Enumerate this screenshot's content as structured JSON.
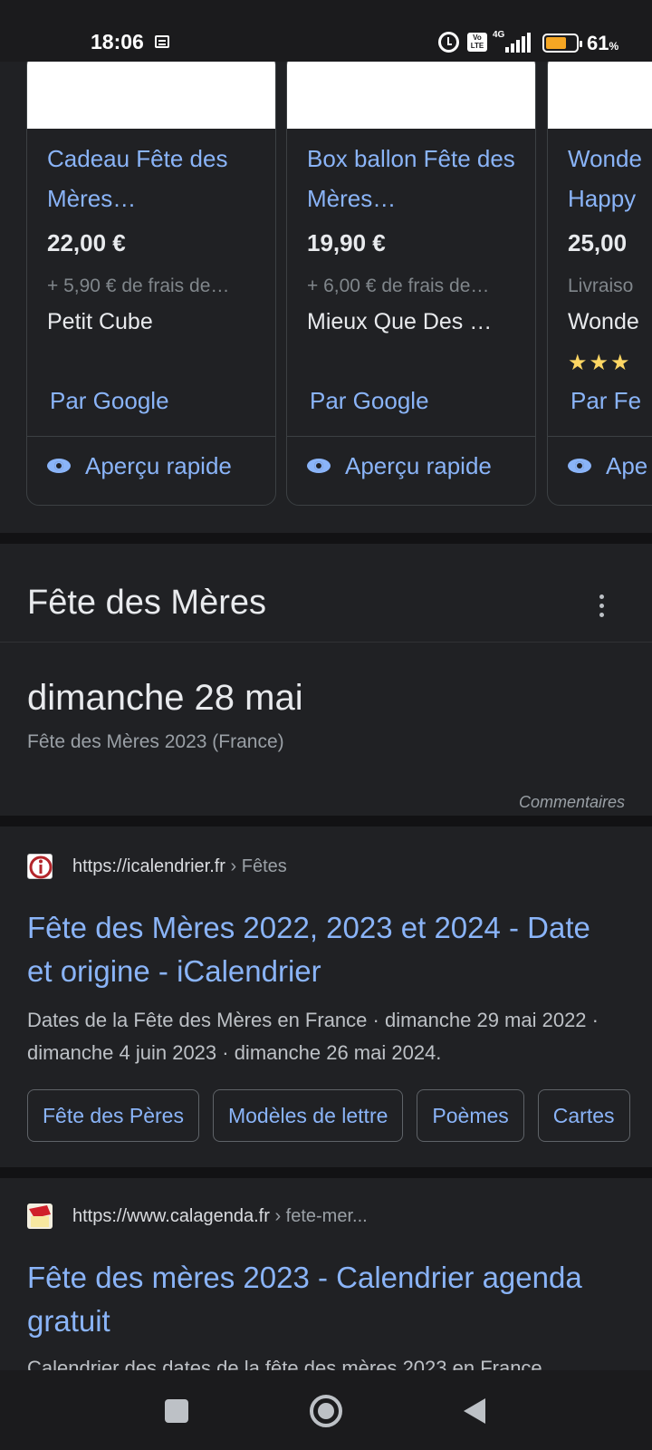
{
  "status_bar": {
    "time": "18:06",
    "network": "4G",
    "volte": "Vo LTE",
    "battery_percent": "61",
    "battery_unit": "%",
    "battery_level": 0.61
  },
  "products": [
    {
      "title": "Cadeau Fête des Mères…",
      "price": "22,00 €",
      "shipping": "+ 5,90 € de frais de…",
      "store": "Petit Cube",
      "stars": "",
      "by": "Par Google",
      "quick_view": "Aperçu rapide"
    },
    {
      "title": "Box ballon Fête des Mères…",
      "price": "19,90 €",
      "shipping": "+ 6,00 € de frais de…",
      "store": "Mieux Que Des …",
      "stars": "",
      "by": "Par Google",
      "quick_view": "Aperçu rapide"
    },
    {
      "title": "Wonde Happy",
      "price": "25,00",
      "shipping": "Livraiso",
      "store": "Wonde",
      "stars": "★★★",
      "by": "Par Fe",
      "quick_view": "Ape"
    }
  ],
  "event": {
    "title": "Fête des Mères",
    "date": "dimanche 28 mai",
    "subtitle": "Fête des Mères 2023 (France)",
    "feedback": "Commentaires"
  },
  "results": [
    {
      "url": "https://icalendrier.fr",
      "path": " › Fêtes",
      "title": "Fête des Mères 2022, 2023 et 2024 - Date et origine - iCalendrier",
      "snippet": "Dates de la Fête des Mères en France · dimanche 29 mai 2022 · dimanche 4 juin 2023 · dimanche 26 mai 2024.",
      "chips": [
        "Fête des Pères",
        "Modèles de lettre",
        "Poèmes",
        "Cartes"
      ]
    },
    {
      "url": "https://www.calagenda.fr",
      "path": " › fete-mer...",
      "title": "Fête des mères 2023 - Calendrier agenda gratuit",
      "snippet": "Calendrier des dates de la fête des mères 2023 en France"
    }
  ],
  "colors": {
    "background": "#202124",
    "link": "#8ab4f8",
    "text": "#e8eaed",
    "muted": "#9aa0a6",
    "star": "#fdd663",
    "battery": "#f5a623"
  },
  "icons": [
    "message-icon",
    "alarm-icon",
    "signal-icon",
    "battery-icon",
    "eye-icon",
    "more-vert-icon",
    "recent-apps-icon",
    "home-icon",
    "back-icon"
  ]
}
